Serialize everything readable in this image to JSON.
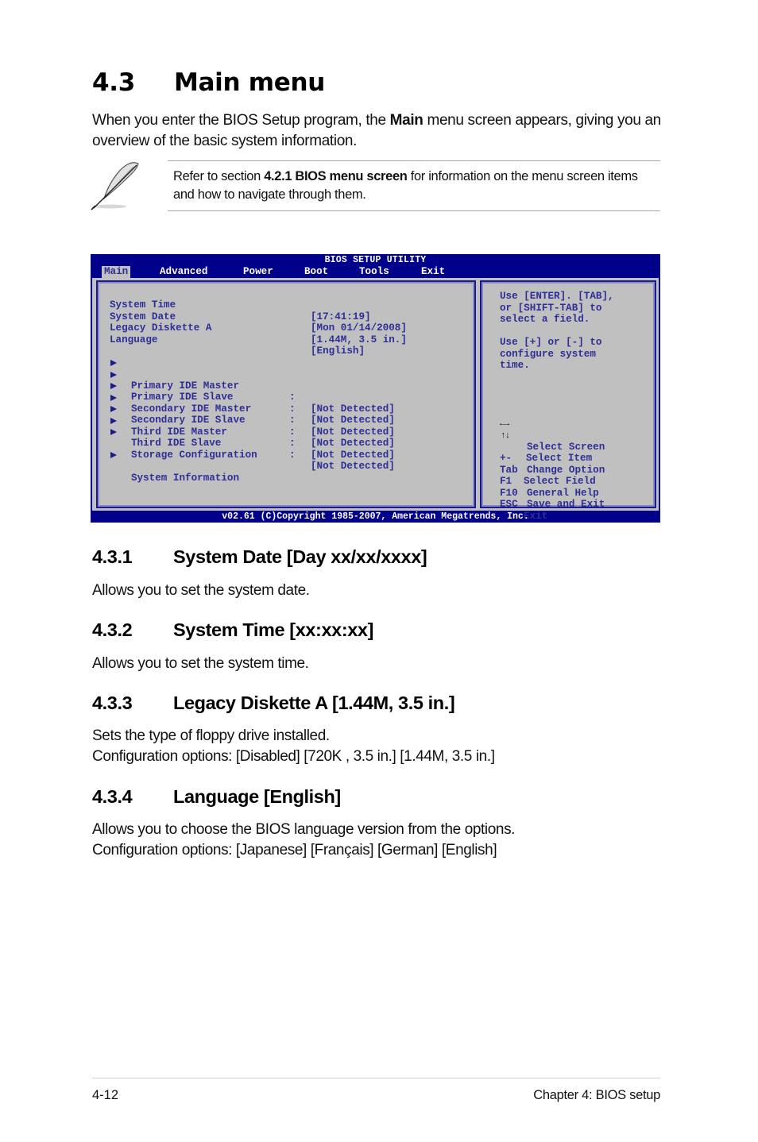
{
  "page": {
    "section": {
      "number": "4.3",
      "title": "Main menu"
    },
    "intro": {
      "before": "When you enter the BIOS Setup program, the ",
      "bold": "Main",
      "after": " menu screen appears, giving you an overview of the basic system information."
    },
    "note": {
      "icon": "feather-pen-icon",
      "before": "Refer to section ",
      "bold": "4.2.1 BIOS menu screen",
      "after": " for information on the menu screen items and how to navigate through them."
    }
  },
  "bios": {
    "title": "BIOS SETUP UTILITY",
    "menu": [
      {
        "label": "Main",
        "active": true
      },
      {
        "label": "Advanced",
        "active": false
      },
      {
        "label": "Power",
        "active": false
      },
      {
        "label": "Boot",
        "active": false
      },
      {
        "label": "Tools",
        "active": false
      },
      {
        "label": "Exit",
        "active": false
      }
    ],
    "settings": [
      {
        "label": "System Time",
        "value": "[17:41:19]"
      },
      {
        "label": "System Date",
        "value": "[Mon 01/14/2008]"
      },
      {
        "label": "Legacy Diskette A",
        "value": "[1.44M, 3.5 in.]"
      },
      {
        "label": "Language",
        "value": "[English]"
      }
    ],
    "submenus": [
      {
        "label": "Primary IDE Master",
        "sep": ":",
        "value": "[Not Detected]"
      },
      {
        "label": "Primary IDE Slave",
        "sep": ":",
        "value": "[Not Detected]"
      },
      {
        "label": "Secondary IDE Master",
        "sep": ":",
        "value": "[Not Detected]"
      },
      {
        "label": "Secondary IDE Slave",
        "sep": ":",
        "value": "[Not Detected]"
      },
      {
        "label": "Third IDE Master",
        "sep": ":",
        "value": "[Not Detected]"
      },
      {
        "label": "Third IDE Slave",
        "sep": ":",
        "value": "[Not Detected]"
      },
      {
        "label": "Storage Configuration"
      },
      {
        "label": "System Information"
      }
    ],
    "help": {
      "lines1": [
        "Use [ENTER]. [TAB],",
        "or [SHIFT-TAB] to",
        "select a field."
      ],
      "lines2": [
        "Use [+] or [-] to",
        "configure system",
        "time."
      ]
    },
    "keys": [
      {
        "key": "←→",
        "icon": "left-right-arrows-icon",
        "action": "Select Screen"
      },
      {
        "key": "↑↓",
        "icon": "up-down-arrows-icon",
        "action": "Select Item"
      },
      {
        "key": "+-",
        "action": "Change Option"
      },
      {
        "key": "Tab",
        "action": "Select Field"
      },
      {
        "key": "F1",
        "action": "General Help"
      },
      {
        "key": "F10",
        "action": "Save and Exit"
      },
      {
        "key": "ESC",
        "action": "Exit"
      }
    ],
    "footer": "v02.61 (C)Copyright 1985-2007, American Megatrends, Inc."
  },
  "subsections": [
    {
      "number": "4.3.1",
      "title": "System Date [Day xx/xx/xxxx]",
      "lines": [
        "Allows you to set the system date."
      ]
    },
    {
      "number": "4.3.2",
      "title": "System Time [xx:xx:xx]",
      "lines": [
        "Allows you to set the system time."
      ]
    },
    {
      "number": "4.3.3",
      "title": "Legacy Diskette A [1.44M, 3.5 in.]",
      "lines": [
        "Sets the type of floppy drive installed.",
        "Configuration options: [Disabled] [720K , 3.5 in.] [1.44M, 3.5 in.]"
      ]
    },
    {
      "number": "4.3.4",
      "title": "Language [English]",
      "lines": [
        "Allows you to choose the BIOS language version from the options.",
        "Configuration options: [Japanese] [Français] [German] [English]"
      ]
    }
  ],
  "footer": {
    "page_number": "4-12",
    "chapter": "Chapter 4: BIOS setup"
  }
}
